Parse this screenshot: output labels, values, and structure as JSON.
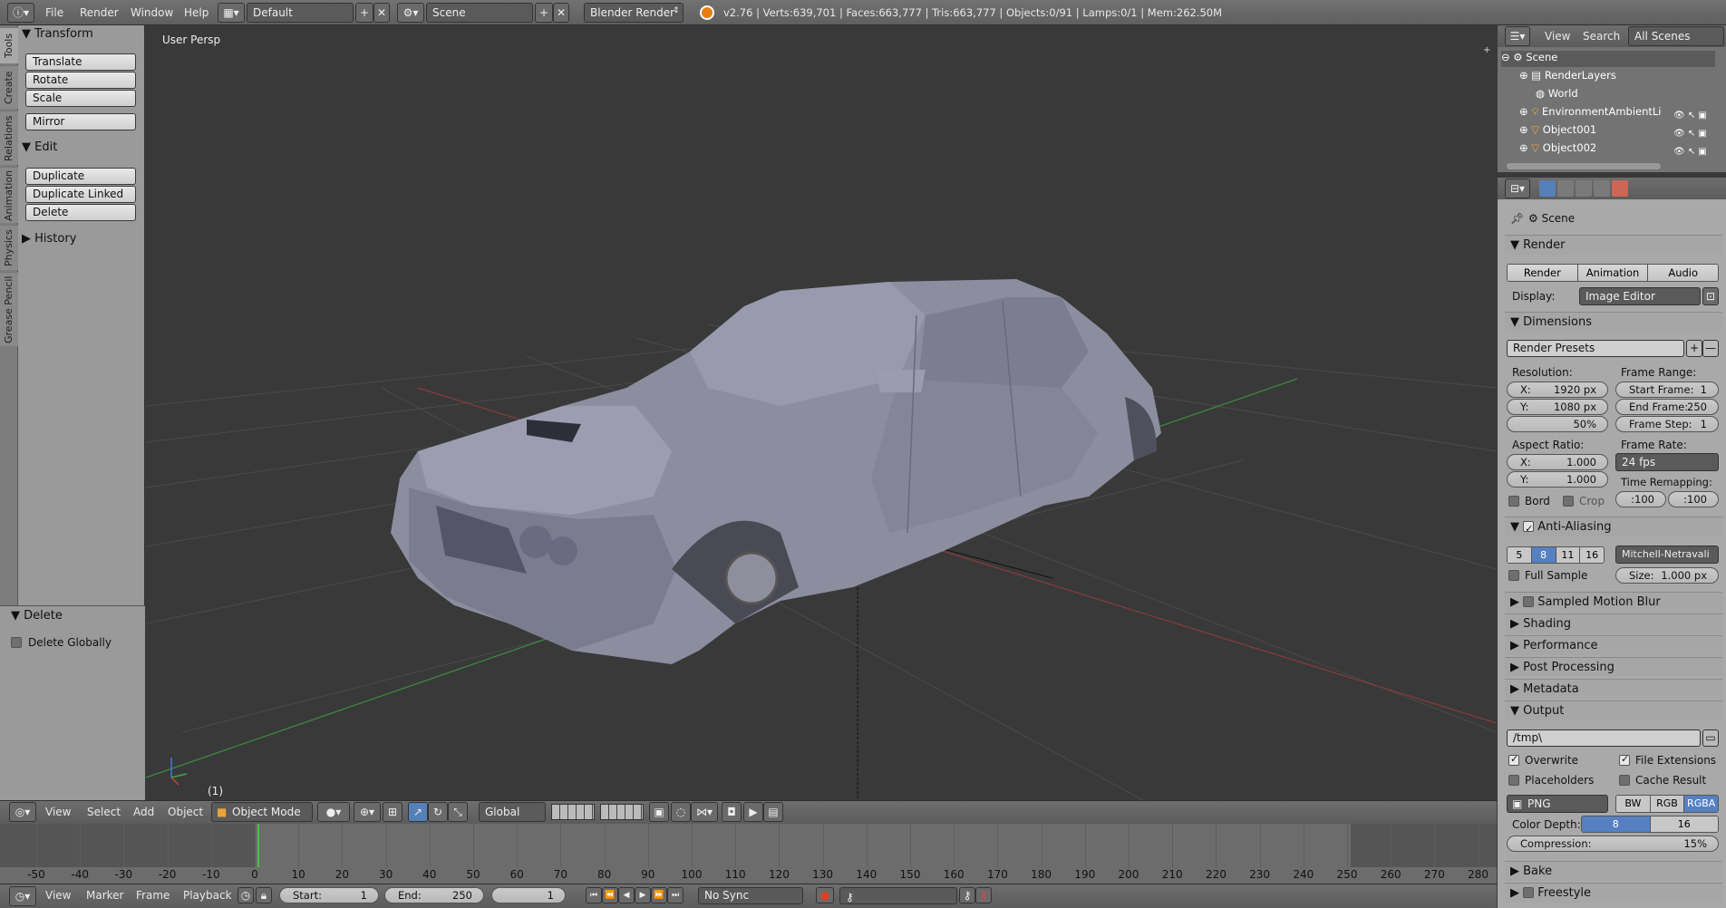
{
  "topbar": {
    "menus": [
      "File",
      "Render",
      "Window",
      "Help"
    ],
    "layout": "Default",
    "scene": "Scene",
    "engine": "Blender Render",
    "stats": "v2.76 | Verts:639,701 | Faces:663,777 | Tris:663,777 | Objects:0/91 | Lamps:0/1 | Mem:262.50M"
  },
  "toolshelf": {
    "tabs": [
      "Tools",
      "Create",
      "Relations",
      "Animation",
      "Physics",
      "Grease Pencil"
    ],
    "transform": {
      "title": "Transform",
      "buttons": [
        "Translate",
        "Rotate",
        "Scale",
        "Mirror"
      ]
    },
    "edit": {
      "title": "Edit",
      "buttons": [
        "Duplicate",
        "Duplicate Linked",
        "Delete"
      ]
    },
    "history": {
      "title": "History"
    },
    "operator": {
      "title": "Delete",
      "option": "Delete Globally"
    }
  },
  "viewport": {
    "label": "User Persp",
    "frame": "(1)",
    "header": {
      "menus": [
        "View",
        "Select",
        "Add",
        "Object"
      ],
      "mode": "Object Mode",
      "orientation": "Global"
    }
  },
  "timeline": {
    "ticks": [
      "-50",
      "-40",
      "-30",
      "-20",
      "-10",
      "0",
      "10",
      "20",
      "30",
      "40",
      "50",
      "60",
      "70",
      "80",
      "90",
      "100",
      "110",
      "120",
      "130",
      "140",
      "150",
      "160",
      "170",
      "180",
      "190",
      "200",
      "210",
      "220",
      "230",
      "240",
      "250",
      "260",
      "270",
      "280"
    ],
    "menus": [
      "View",
      "Marker",
      "Frame",
      "Playback"
    ],
    "start_label": "Start:",
    "start": "1",
    "end_label": "End:",
    "end": "250",
    "current": "1",
    "sync": "No Sync"
  },
  "outliner": {
    "menus": [
      "View",
      "Search"
    ],
    "filter": "All Scenes",
    "items": [
      "Scene",
      "RenderLayers",
      "World",
      "EnvironmentAmbientLi",
      "Object001",
      "Object002"
    ]
  },
  "properties": {
    "context": "Scene",
    "render": {
      "title": "Render",
      "buttons": [
        "Render",
        "Animation",
        "Audio"
      ],
      "display_label": "Display:",
      "display": "Image Editor"
    },
    "dimensions": {
      "title": "Dimensions",
      "presets": "Render Presets",
      "resolution_label": "Resolution:",
      "res_x_label": "X:",
      "res_x": "1920 px",
      "res_y_label": "Y:",
      "res_y": "1080 px",
      "res_pct": "50%",
      "frame_range_label": "Frame Range:",
      "start_label": "Start Frame:",
      "start": "1",
      "end_label": "End Frame:",
      "end": "250",
      "step_label": "Frame Step:",
      "step": "1",
      "aspect_label": "Aspect Ratio:",
      "asp_x_label": "X:",
      "asp_x": "1.000",
      "asp_y_label": "Y:",
      "asp_y": "1.000",
      "frame_rate_label": "Frame Rate:",
      "fps": "24 fps",
      "remap_label": "Time Remapping:",
      "remap_old": ":100",
      "remap_new": ":100",
      "bord": "Bord",
      "crop": "Crop"
    },
    "aa": {
      "title": "Anti-Aliasing",
      "samples": [
        "5",
        "8",
        "11",
        "16"
      ],
      "filter": "Mitchell-Netravali",
      "full_sample": "Full Sample",
      "size_label": "Size:",
      "size": "1.000 px"
    },
    "sections": [
      "Sampled Motion Blur",
      "Shading",
      "Performance",
      "Post Processing",
      "Metadata"
    ],
    "output": {
      "title": "Output",
      "path": "/tmp\\",
      "overwrite": "Overwrite",
      "file_ext": "File Extensions",
      "placeholders": "Placeholders",
      "cache": "Cache Result",
      "format": "PNG",
      "modes": [
        "BW",
        "RGB",
        "RGBA"
      ],
      "depth_label": "Color Depth:",
      "depths": [
        "8",
        "16"
      ],
      "compression_label": "Compression:",
      "compression": "15%"
    },
    "bottom_sections": [
      "Bake",
      "Freestyle"
    ]
  }
}
